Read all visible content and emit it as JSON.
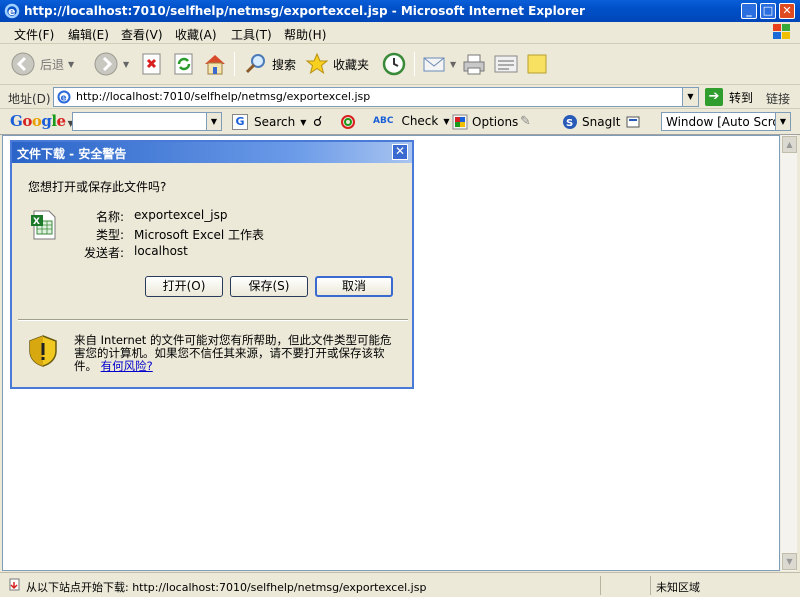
{
  "window": {
    "title": "http://localhost:7010/selfhelp/netmsg/exportexcel.jsp - Microsoft Internet Explorer",
    "min": "_",
    "max": "□",
    "close": "✕"
  },
  "menu": [
    "文件(F)",
    "编辑(E)",
    "查看(V)",
    "收藏(A)",
    "工具(T)",
    "帮助(H)"
  ],
  "toolbar": {
    "back": "后退",
    "search": "搜索",
    "favorites": "收藏夹"
  },
  "address": {
    "label": "地址(D)",
    "url": "http://localhost:7010/selfhelp/netmsg/exportexcel.jsp",
    "go": "转到",
    "links": "链接"
  },
  "googlebar": {
    "search": "Search",
    "check": "Check",
    "options": "Options",
    "snagit": "SnagIt",
    "window_select": "Window [Auto Scroll]"
  },
  "dialog": {
    "title": "文件下载 - 安全警告",
    "question": "您想打开或保存此文件吗?",
    "name_key": "名称:",
    "name_val": "exportexcel_jsp",
    "type_key": "类型:",
    "type_val": "Microsoft Excel 工作表",
    "from_key": "发送者:",
    "from_val": "localhost",
    "open": "打开(O)",
    "save": "保存(S)",
    "cancel": "取消",
    "warning": "来自 Internet 的文件可能对您有所帮助，但此文件类型可能危害您的计算机。如果您不信任其来源，请不要打开或保存该软件。",
    "risk_link": "有何风险?"
  },
  "status": {
    "text": "从以下站点开始下载: http://localhost:7010/selfhelp/netmsg/exportexcel.jsp",
    "zone": "未知区域"
  }
}
